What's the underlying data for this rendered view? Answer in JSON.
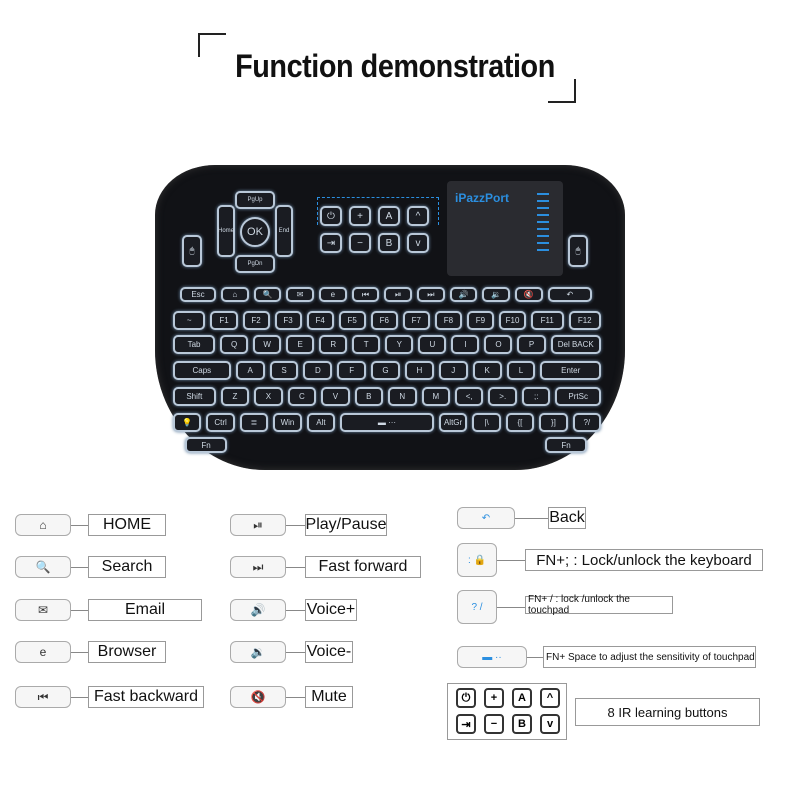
{
  "title": "Function demonstration",
  "brand": "iPazzPort",
  "dpad": {
    "ok": "OK",
    "up": "PgUp",
    "down": "PgDn",
    "left": "Home",
    "right": "End"
  },
  "ir_keys": [
    "⏻",
    "+",
    "A",
    "^",
    "⇥",
    "−",
    "B",
    "v"
  ],
  "rows": [
    [
      "Esc",
      "⌂",
      "🔍",
      "✉",
      "e",
      "⏮",
      "⏯",
      "⏭",
      "🔊",
      "🔉",
      "🔇",
      "↶"
    ],
    [
      "~",
      "F1",
      "F2",
      "F3",
      "F4",
      "F5",
      "F6",
      "F7",
      "F8",
      "F9",
      "F10",
      "F11",
      "F12"
    ],
    [
      "Tab",
      "Q",
      "W",
      "E",
      "R",
      "T",
      "Y",
      "U",
      "I",
      "O",
      "P",
      "Del BACK"
    ],
    [
      "Caps",
      "A",
      "S",
      "D",
      "F",
      "G",
      "H",
      "J",
      "K",
      "L",
      "Enter"
    ],
    [
      "Shift",
      "Z",
      "X",
      "C",
      "V",
      "B",
      "N",
      "M",
      "<,",
      ">.",
      ";:",
      "PrtSc"
    ],
    [
      "💡",
      "Ctrl",
      "≣",
      "Win",
      "Alt",
      "▬ ···",
      "AltGr",
      "|\\",
      "{[",
      "}]",
      "?/"
    ],
    [
      "Fn",
      "Fn"
    ]
  ],
  "legend": {
    "left": [
      {
        "icon": "⌂",
        "label": "HOME"
      },
      {
        "icon": "🔍",
        "label": "Search"
      },
      {
        "icon": "✉",
        "label": "Email"
      },
      {
        "icon": "e",
        "label": "Browser"
      },
      {
        "icon": "⏮",
        "label": "Fast backward"
      }
    ],
    "middle": [
      {
        "icon": "⏯",
        "label": "Play/Pause"
      },
      {
        "icon": "⏭",
        "label": "Fast forward"
      },
      {
        "icon": "🔊",
        "label": "Voice+"
      },
      {
        "icon": "🔉",
        "label": "Voice-"
      },
      {
        "icon": "🔇",
        "label": "Mute"
      }
    ],
    "right": [
      {
        "icon": "↶",
        "label": "Back"
      },
      {
        "icon": ": 🔒",
        "label": "FN+; :  Lock/unlock the keyboard"
      },
      {
        "icon": "? /",
        "label": "FN+ / : lock /unlock the touchpad"
      },
      {
        "icon": "▬ ··",
        "label": "FN+ Space to adjust the sensitivity of touchpad"
      }
    ],
    "ir_label": "8 IR learning buttons"
  },
  "colors": {
    "accent": "#2b8fe0",
    "body": "#111216",
    "backlight": "#b9c8d8"
  }
}
